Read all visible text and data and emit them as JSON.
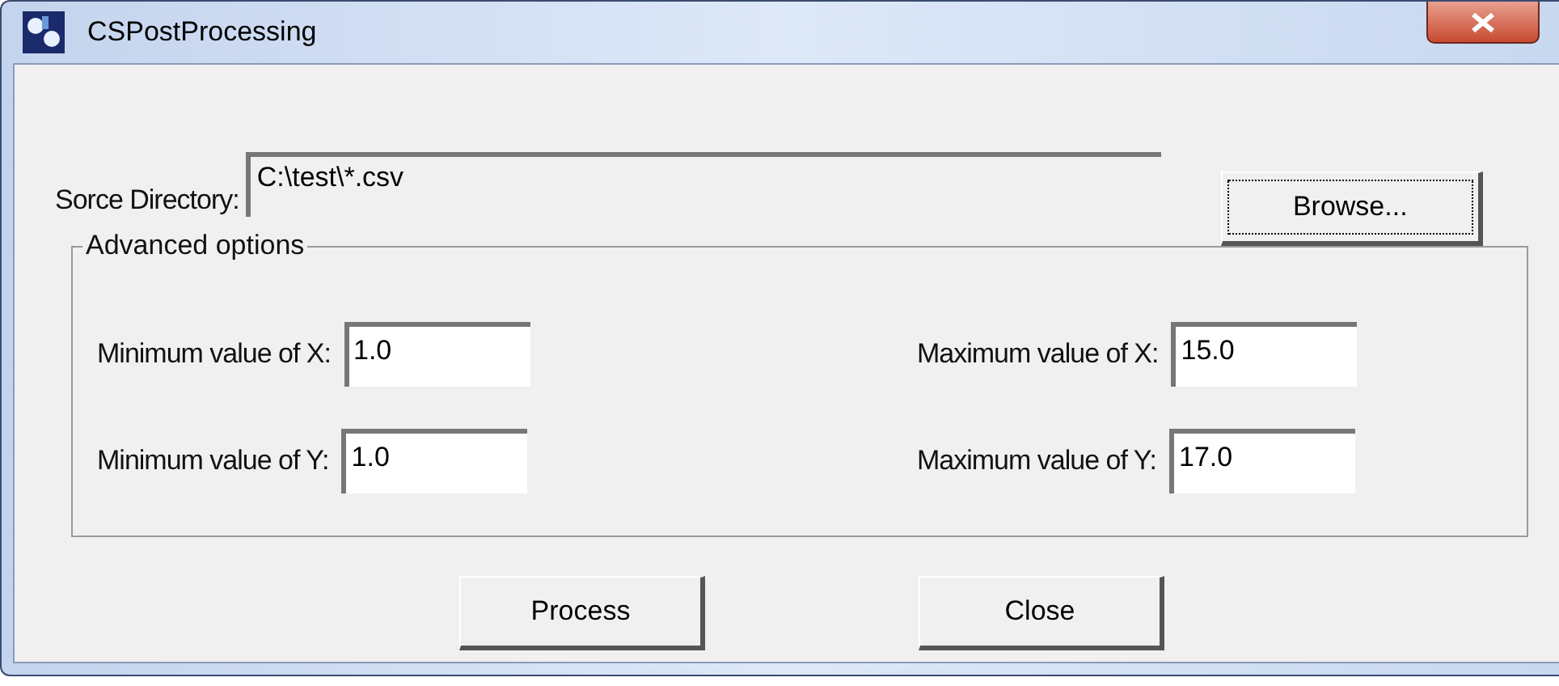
{
  "window": {
    "title": "CSPostProcessing"
  },
  "source": {
    "label": "Sorce Directory:",
    "value": "C:\\test\\*.csv",
    "browse": "Browse..."
  },
  "group": {
    "title": "Advanced options",
    "fields": [
      {
        "label": "Minimum value of X:",
        "value": "1.0"
      },
      {
        "label": "Maximum value of X:",
        "value": "15.0"
      },
      {
        "label": "Minimum value of Y:",
        "value": "1.0"
      },
      {
        "label": "Maximum value of Y:",
        "value": "17.0"
      }
    ]
  },
  "buttons": [
    "Process",
    "Close"
  ]
}
